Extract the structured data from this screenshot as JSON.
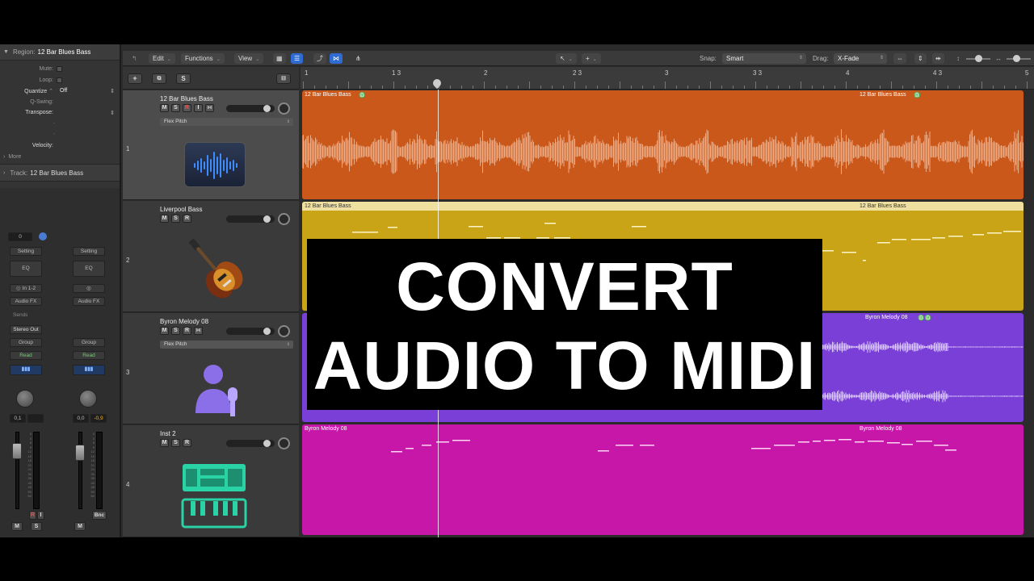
{
  "inspector": {
    "region_label": "Region:",
    "region_name": "12 Bar Blues Bass",
    "mute_label": "Mute:",
    "loop_label": "Loop:",
    "quantize_label": "Quantize",
    "quantize_value": "Off",
    "qswing_label": "Q-Swing:",
    "transpose_label": "Transpose:",
    "dash": "-",
    "velocity_label": "Velocity:",
    "more_label": "More",
    "track_label": "Track:",
    "track_name": "12 Bar Blues Bass"
  },
  "strips": [
    {
      "value": "0",
      "setting": "Setting",
      "eq": "EQ",
      "input": "In 1-2",
      "audio_fx": "Audio FX",
      "sends": "Sends",
      "output": "Stereo Out",
      "group": "Group",
      "automation": "Read",
      "pan_value": "0,1",
      "mute": "M",
      "solo": "S",
      "rec": "R",
      "input_mon": "I"
    },
    {
      "setting": "Setting",
      "eq": "EQ",
      "audio_fx": "Audio FX",
      "group": "Group",
      "automation": "Read",
      "pan_value": "0,0",
      "peak_value": "-0,9",
      "bounce": "Bnc",
      "mute": "M"
    }
  ],
  "meter_scale": [
    "0",
    "3",
    "6",
    "9",
    "12",
    "15",
    "18",
    "21",
    "24",
    "30",
    "35",
    "40",
    "45",
    "50",
    "60"
  ],
  "toolbar": {
    "edit": "Edit",
    "functions": "Functions",
    "view": "View",
    "snap_label": "Snap:",
    "snap_value": "Smart",
    "drag_label": "Drag:",
    "drag_value": "X-Fade"
  },
  "header_buttons": {
    "add": "+",
    "solo": "S"
  },
  "ruler": {
    "marks": [
      "1",
      "1 3",
      "2",
      "2 3",
      "3",
      "3 3",
      "4",
      "4 3",
      "5"
    ]
  },
  "tracks": [
    {
      "number": "1",
      "name": "12 Bar Blues Bass",
      "mute": "M",
      "solo": "S",
      "rec": "R",
      "input": "I",
      "flex_mode": "Flex Pitch"
    },
    {
      "number": "2",
      "name": "Liverpool Bass",
      "mute": "M",
      "solo": "S",
      "rec": "R"
    },
    {
      "number": "3",
      "name": "Byron Melody 08",
      "mute": "M",
      "solo": "S",
      "rec": "R",
      "flex_mode": "Flex Pitch"
    },
    {
      "number": "4",
      "name": "Inst 2",
      "mute": "M",
      "solo": "S",
      "rec": "R"
    }
  ],
  "regions": [
    {
      "label_left": "12 Bar Blues Bass",
      "label_right": "12 Bar Blues Bass",
      "color": "#c9581a"
    },
    {
      "label_left": "12 Bar Blues Bass",
      "label_right": "12 Bar Blues Bass",
      "color": "#c8a416"
    },
    {
      "label_left": "",
      "label_right": "Byron Melody 08",
      "color": "#7a3fd6"
    },
    {
      "label_left": "Byron Melody 08",
      "label_right": "Byron Melody 08",
      "color": "#c617a8"
    }
  ],
  "overlay": {
    "line1": "CONVERT",
    "line2": "AUDIO TO MIDI"
  },
  "colors": {
    "accent": "#2f6bd1",
    "audio_orange": "#c9581a",
    "midi_yellow": "#c8a416",
    "audio_purple": "#7a3fd6",
    "midi_magenta": "#c617a8"
  }
}
